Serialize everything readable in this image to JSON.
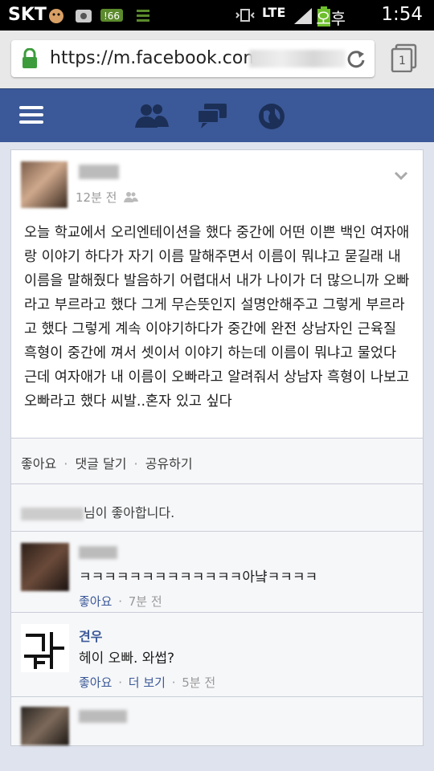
{
  "status": {
    "carrier": "SKT",
    "network": "LTE",
    "ampm": "오후",
    "time": "1:54"
  },
  "browser": {
    "url": "https://m.facebook.com",
    "tab_count": "1"
  },
  "fb_nav": {
    "icons": [
      "menu-icon",
      "friends-icon",
      "messages-icon",
      "globe-icon"
    ]
  },
  "post": {
    "time": "12분 전",
    "body": "오늘 학교에서 오리엔테이션을 했다 중간에 어떤 이쁜 백인 여자애랑 이야기 하다가 자기 이름 말해주면서 이름이 뭐냐고 묻길래 내이름을 말해줬다 발음하기 어렵대서 내가 나이가 더 많으니까 오빠라고 부르라고 했다 그게 무슨뜻인지 설명안해주고 그렇게 부르라고 했다 그렇게 계속 이야기하다가 중간에 완전 상남자인 근육질 흑형이 중간에 껴서 셋이서 이야기 하는데 이름이 뭐냐고 물었다 근데 여자애가 내 이름이 오빠라고 알려줘서 상남자 흑형이 나보고 오빠라고 했다 씨발..혼자 있고 싶다"
  },
  "actions": {
    "like": "좋아요",
    "comment": "댓글 달기",
    "share": "공유하기",
    "sep": "·"
  },
  "likes_line": {
    "text": "님이 좋아합니다."
  },
  "comments": [
    {
      "name": "",
      "text": "ㅋㅋㅋㅋㅋㅋㅋㅋㅋㅋㅋㅋㅋ아냨ㅋㅋㅋㅋ",
      "like": "좋아요",
      "time": "7분 전"
    },
    {
      "name": "견우",
      "text": "헤이 오빠. 와썹?",
      "like": "좋아요",
      "more": "더 보기",
      "time": "5분 전",
      "avatar_text": "그늶하"
    }
  ]
}
